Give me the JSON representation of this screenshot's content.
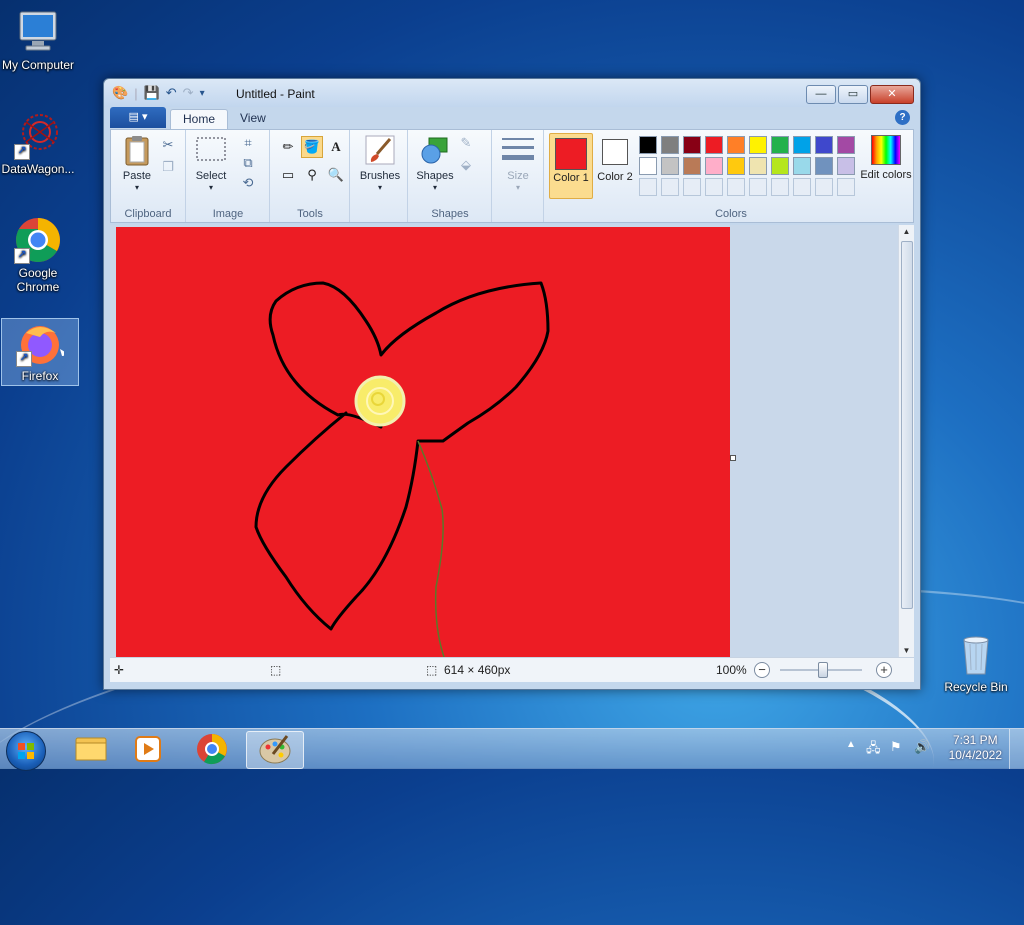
{
  "desktop": {
    "icons": [
      {
        "label": "My Computer"
      },
      {
        "label": "DataWagon..."
      },
      {
        "label": "Google Chrome"
      },
      {
        "label": "Firefox"
      },
      {
        "label": "Recycle Bin"
      }
    ]
  },
  "window": {
    "title": "Untitled - Paint",
    "controls": {
      "minimize": "—",
      "maximize": "▭",
      "close": "✕"
    }
  },
  "ribbon": {
    "tabs": [
      "Home",
      "View"
    ],
    "file_menu_glyph": "▤ ▾",
    "help_glyph": "?",
    "groups": {
      "clipboard": {
        "label": "Clipboard",
        "paste": "Paste"
      },
      "image": {
        "label": "Image",
        "select": "Select"
      },
      "tools": {
        "label": "Tools"
      },
      "brushes": {
        "label": "Brushes"
      },
      "shapes": {
        "label": "Shapes",
        "shapes_btn": "Shapes"
      },
      "size": {
        "label": "Size"
      },
      "colors": {
        "label": "Colors",
        "color1": "Color 1",
        "color2": "Color 2",
        "edit": "Edit colors",
        "color1_value": "#ed1c24",
        "color2_value": "#ffffff",
        "palette_row1": [
          "#000000",
          "#7f7f7f",
          "#880015",
          "#ed1c24",
          "#ff7f27",
          "#fff200",
          "#22b14c",
          "#00a2e8",
          "#3f48cc",
          "#a349a4"
        ],
        "palette_row2": [
          "#ffffff",
          "#c3c3c3",
          "#b97a57",
          "#ffaec9",
          "#ffc90e",
          "#efe4b0",
          "#b5e61d",
          "#99d9ea",
          "#7092be",
          "#c8bfe7"
        ]
      }
    }
  },
  "canvas": {
    "background": "#ed1c24"
  },
  "status": {
    "size": "614 × 460px",
    "zoom": "100%"
  },
  "taskbar": {
    "clock_time": "7:31 PM",
    "clock_date": "10/4/2022"
  }
}
